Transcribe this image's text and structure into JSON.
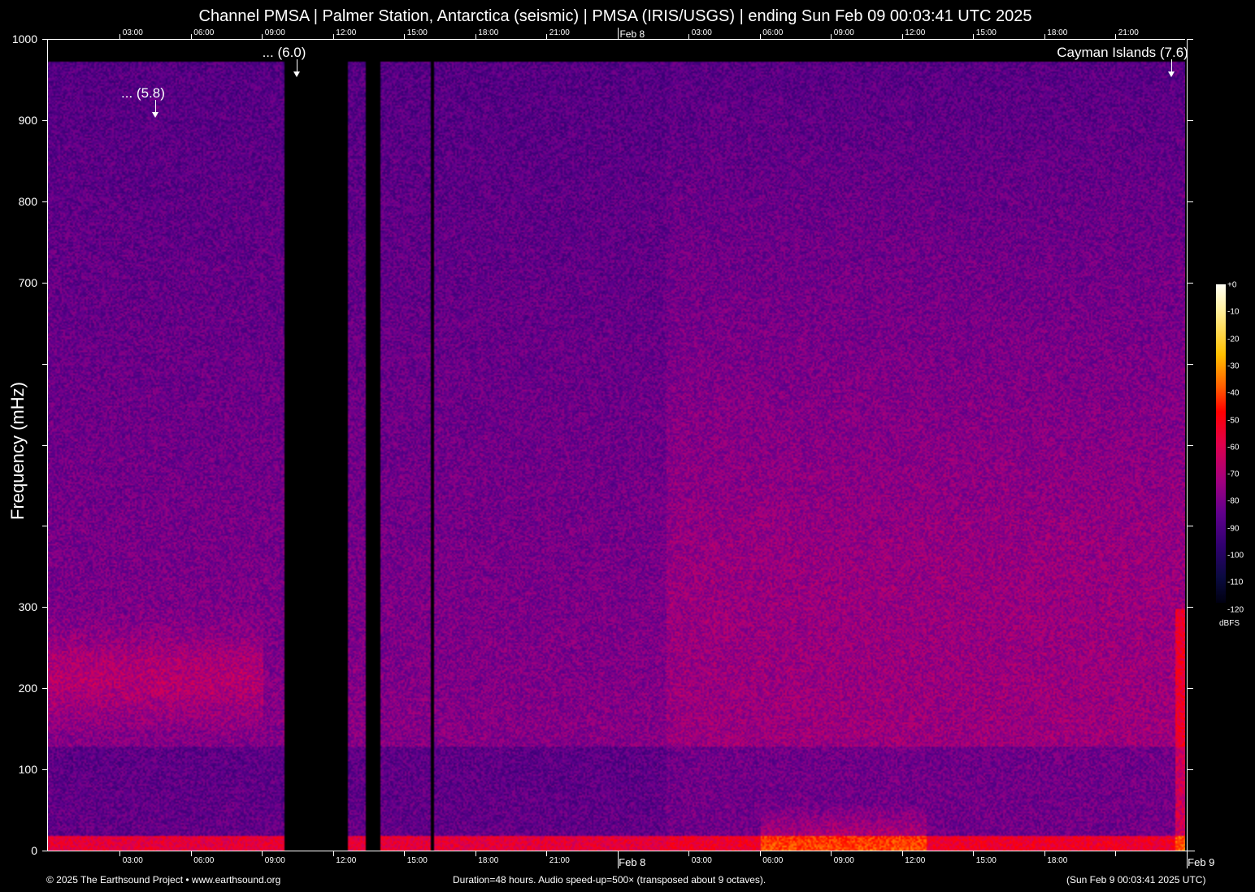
{
  "title": "Channel PMSA | Palmer Station, Antarctica (seismic) | PMSA (IRIS/USGS) | ending Sun Feb 09 00:03:41 UTC 2025",
  "chart_data": {
    "type": "heatmap",
    "title": "Channel PMSA | Palmer Station, Antarctica (seismic) | PMSA (IRIS/USGS) | ending Sun Feb 09 00:03:41 UTC 2025",
    "ylabel": "Frequency (mHz)",
    "ylim": [
      0,
      1000
    ],
    "y_ticks": [
      0,
      100,
      200,
      300,
      400,
      500,
      600,
      700,
      800,
      900,
      1000
    ],
    "y_tick_labels": [
      "0",
      "100",
      "200",
      "300",
      "",
      "",
      "",
      "700",
      "800",
      "900",
      "1000"
    ],
    "x_duration_hours": 48,
    "x_start_offset_hours": -0.0614,
    "x_tick_labels_bottom": [
      "03:00",
      "06:00",
      "09:00",
      "12:00",
      "15:00",
      "18:00",
      "21:00",
      "Feb  8",
      "03:00",
      "06:00",
      "09:00",
      "12:00",
      "15:00",
      "18:00",
      "",
      "Feb  9"
    ],
    "x_tick_labels_top": [
      "03:00",
      "06:00",
      "09:00",
      "12:00",
      "15:00",
      "18:00",
      "21:00",
      "Feb  8",
      "03:00",
      "06:00",
      "09:00",
      "12:00",
      "15:00",
      "18:00",
      "21:00"
    ],
    "data_gaps_hours": [
      [
        9.9,
        12.6
      ],
      [
        13.35,
        13.95
      ],
      [
        16.1,
        16.2
      ]
    ],
    "annotations": [
      {
        "label": "... (5.8)",
        "hour": 4.5,
        "freq": 910
      },
      {
        "label": "... (6.0)",
        "hour": 10.45,
        "freq": 960
      },
      {
        "label": "Cayman Islands (7.6)",
        "hour": 47.35,
        "freq": 960
      }
    ],
    "colorbar": {
      "label": "dBFS",
      "ticks": [
        "+0",
        "-10",
        "-20",
        "-30",
        "-40",
        "-50",
        "-60",
        "-70",
        "-80",
        "-90",
        "-100",
        "-110",
        "-120"
      ],
      "range": [
        -120,
        0
      ]
    }
  },
  "footer": {
    "left": "© 2025 The Earthsound Project • www.earthsound.org",
    "center": "Duration=48 hours. Audio speed-up=500× (transposed about 9 octaves).",
    "right": "(Sun Feb  9 00:03:41 2025 UTC)"
  }
}
